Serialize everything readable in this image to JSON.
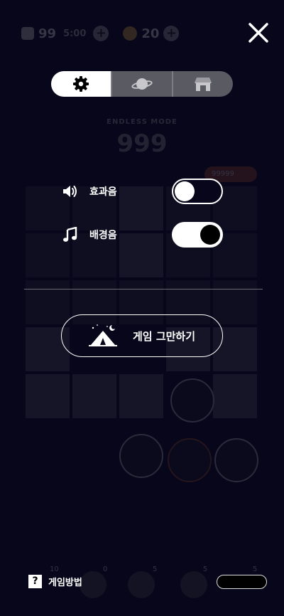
{
  "hud": {
    "gems": "99",
    "timer": "5:00",
    "coins": "20",
    "plus": "+"
  },
  "mode": {
    "label": "ENDLESS MODE",
    "score": "999"
  },
  "best": {
    "value": "99999"
  },
  "tabs": [
    {
      "name": "settings",
      "icon": "gear-icon",
      "active": true
    },
    {
      "name": "planet",
      "icon": "planet-icon",
      "active": false
    },
    {
      "name": "shop",
      "icon": "shop-icon",
      "active": false
    }
  ],
  "settings": {
    "sound_effects": {
      "label": "효과음",
      "icon": "speaker-icon",
      "enabled": false
    },
    "bgm": {
      "label": "배경음",
      "icon": "music-note-icon",
      "enabled": true
    }
  },
  "quit": {
    "label": "게임 그만하기",
    "icon": "tent-icon"
  },
  "help": {
    "q": "?",
    "label": "게임방법"
  },
  "items": {
    "item1": "10",
    "item2": "0",
    "item3": "5",
    "item4": "5",
    "item5": "5"
  },
  "colors": {
    "background": "#07061a",
    "accent": "#ffffff",
    "tab_inactive": "#5a5a62"
  }
}
